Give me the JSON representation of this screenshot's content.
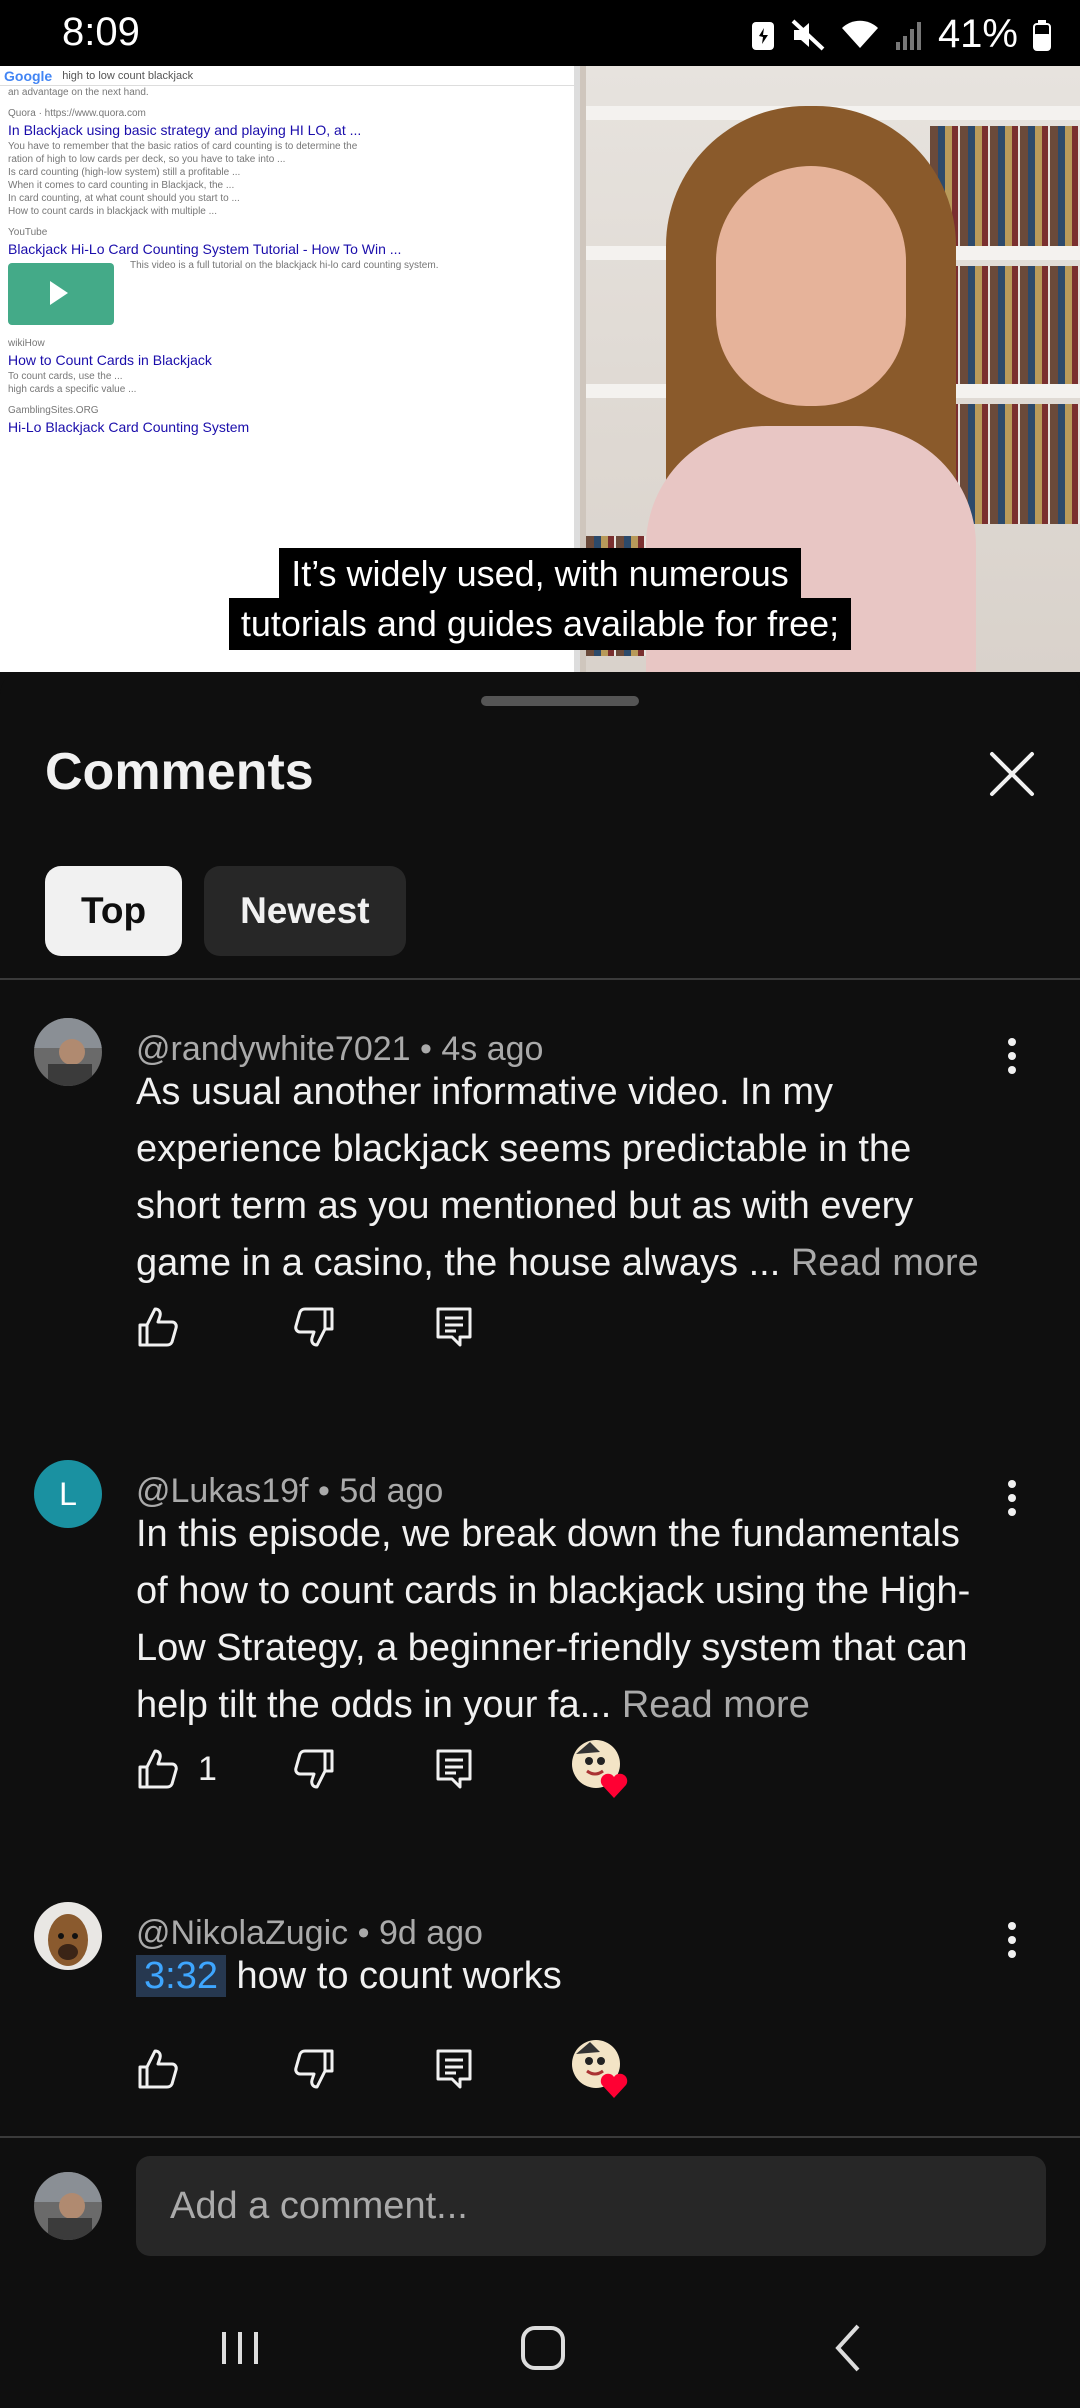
{
  "status_bar": {
    "time": "8:09",
    "battery": "41%"
  },
  "video": {
    "caption_line1": "It’s widely used, with numerous",
    "caption_line2": "tutorials and guides available for free;",
    "progress_fraction": 0.59,
    "search": {
      "query": "high to low count blackjack",
      "result1_title": "In Blackjack using basic strategy and playing HI LO, at ...",
      "result2_site": "YouTube",
      "result2_title": "Blackjack Hi-Lo Card Counting System Tutorial - How To Win ...",
      "result3_site": "wikiHow",
      "result3_title": "How to Count Cards in Blackjack",
      "result4_site": "GamblingSites.ORG",
      "result4_title": "Hi-Lo Blackjack Card Counting System"
    }
  },
  "panel": {
    "title": "Comments",
    "tabs": [
      "Top",
      "Newest"
    ]
  },
  "comments": [
    {
      "author": "@randywhite7021",
      "time": "4s ago",
      "text": "As usual another informative video. In my experience blackjack seems predictable in the short term as you mentioned but as with every game in a casino, the house always ...",
      "read_more": "Read more",
      "likes": "",
      "hearted": false
    },
    {
      "author": "@Lukas19f",
      "avatar_letter": "L",
      "time": "5d ago",
      "text": "In this episode, we break down the fundamentals of how to count cards in blackjack using the High-Low Strategy, a beginner-friendly system that can help tilt the odds in your fa...",
      "read_more": "Read more",
      "likes": "1",
      "hearted": true
    },
    {
      "author": "@NikolaZugic",
      "time": "9d ago",
      "timestamp": "3:32",
      "text": "how to count works",
      "likes": "",
      "hearted": true
    }
  ],
  "add_comment": {
    "placeholder": "Add a comment..."
  },
  "colors": {
    "background": "#0f0f0f",
    "chip_active": "#f1f1f1",
    "link_blue": "#3ea6ff",
    "heart": "#ff0033"
  },
  "icons": [
    "mute-icon",
    "wifi-icon",
    "signal-icon",
    "battery-icon",
    "close-icon",
    "like-icon",
    "dislike-icon",
    "reply-icon",
    "more-icon",
    "heart-icon",
    "recents-icon",
    "home-icon",
    "back-icon"
  ]
}
